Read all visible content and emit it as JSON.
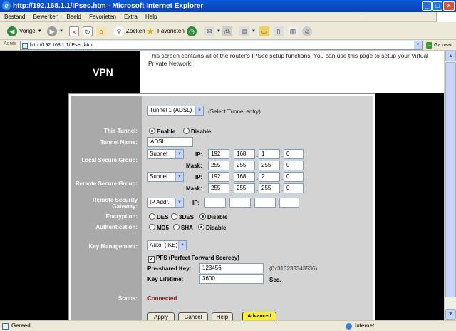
{
  "window": {
    "title": "http://192.168.1.1/IPsec.htm - Microsoft Internet Explorer"
  },
  "menu": [
    "Bestand",
    "Bewerken",
    "Beeld",
    "Favorieten",
    "Extra",
    "Help"
  ],
  "toolbar": {
    "back_label": "Vorige",
    "search_label": "Zoeken",
    "favorites_label": "Favorieten"
  },
  "address": {
    "label": "Adres",
    "url": "http://192.168.1.1/IPsec.htm",
    "go_label": "Ga naar"
  },
  "page": {
    "heading": "VPN",
    "description": "This screen contains all of the router's IPSec setup functions. You can use this page to setup your Virtual Private Network."
  },
  "form": {
    "tunnel_select": "Tunnel 1 (ADSL)",
    "tunnel_hint": "(Select Tunnel entry)",
    "this_tunnel_label": "This Tunnel:",
    "enable_label": "Enable",
    "disable_label": "Disable",
    "tunnel_name_label": "Tunnel Name:",
    "tunnel_name": "ADSL",
    "local_group_label": "Local Secure Group:",
    "local_type": "Subnet",
    "ip_label": "IP:",
    "mask_label": "Mask:",
    "local_ip": [
      "192",
      "168",
      "1",
      "0"
    ],
    "local_mask": [
      "255",
      "255",
      "255",
      "0"
    ],
    "remote_group_label": "Remote Secure Group:",
    "remote_type": "Subnet",
    "remote_ip": [
      "192",
      "168",
      "2",
      "0"
    ],
    "remote_mask": [
      "255",
      "255",
      "255",
      "0"
    ],
    "remote_gateway_label": "Remote Security Gateway:",
    "gateway_type": "IP Addr.",
    "gateway_ip": [
      "",
      "",
      "",
      ""
    ],
    "encryption_label": "Encryption:",
    "enc_des": "DES",
    "enc_3des": "3DES",
    "enc_disable": "Disable",
    "auth_label": "Authentication:",
    "auth_md5": "MD5",
    "auth_sha": "SHA",
    "auth_disable": "Disable",
    "key_mgmt_label": "Key Management:",
    "key_mgmt": "Auto. (IKE)",
    "pfs_label": "PFS (Perfect Forward Secrecy)",
    "psk_label": "Pre-shared Key:",
    "psk": "123456",
    "psk_hex": "(0x313233343536)",
    "lifetime_label": "Key Lifetime:",
    "lifetime": "3600",
    "lifetime_unit": "Sec.",
    "status_label": "Status:",
    "status": "Connected",
    "apply": "Apply",
    "cancel": "Cancel",
    "help": "Help",
    "advanced": "Advanced"
  },
  "statusbar": {
    "left": "Gereed",
    "zone": "Internet"
  }
}
